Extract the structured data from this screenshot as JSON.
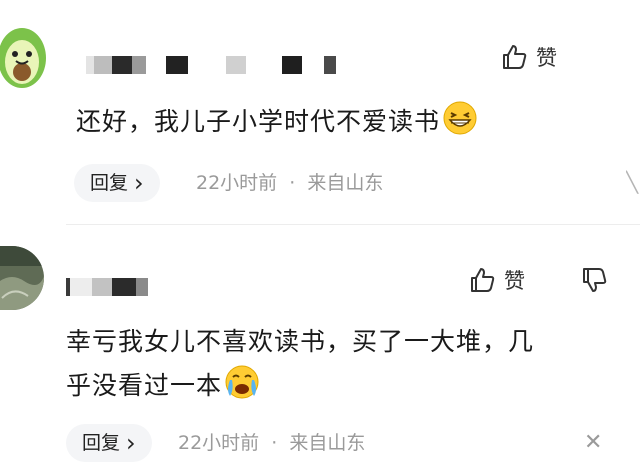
{
  "comments": [
    {
      "text": "还好，我儿子小学时代不爱读书",
      "emoji": "grinning-squinting-face",
      "reply_label": "回复",
      "reply_chevron": "›",
      "time": "22小时前",
      "separator": "·",
      "location": "来自山东",
      "like_label": "赞"
    },
    {
      "text_line1": "幸亏我女儿不喜欢读书，买了一大堆，几",
      "text_line2": "乎没看过一本",
      "emoji": "loudly-crying-face",
      "reply_label": "回复",
      "reply_chevron": "›",
      "time": "22小时前",
      "separator": "·",
      "location": "来自山东",
      "like_label": "赞",
      "close_glyph": "✕"
    }
  ],
  "colors": {
    "avatar1_bg": "#7cc24a",
    "avatar2_bg": "#5f6b55",
    "reply_bg": "#f4f5f7",
    "meta_text": "#9a9a9a"
  }
}
